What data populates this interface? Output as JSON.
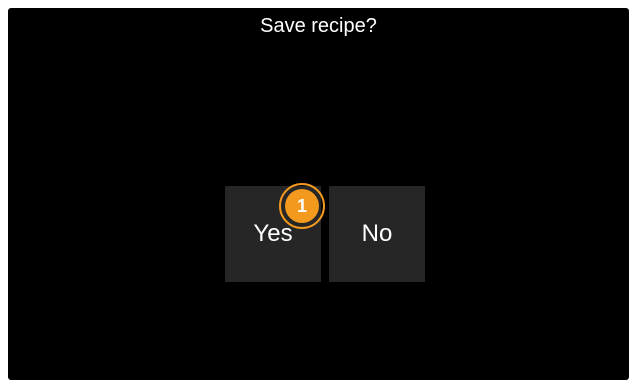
{
  "dialog": {
    "title": "Save recipe?",
    "yes_label": "Yes",
    "no_label": "No"
  },
  "annotation": {
    "step_number": "1",
    "color": "#f39a1e"
  },
  "colors": {
    "background": "#000000",
    "button_bg": "#262626",
    "text": "#ffffff"
  }
}
